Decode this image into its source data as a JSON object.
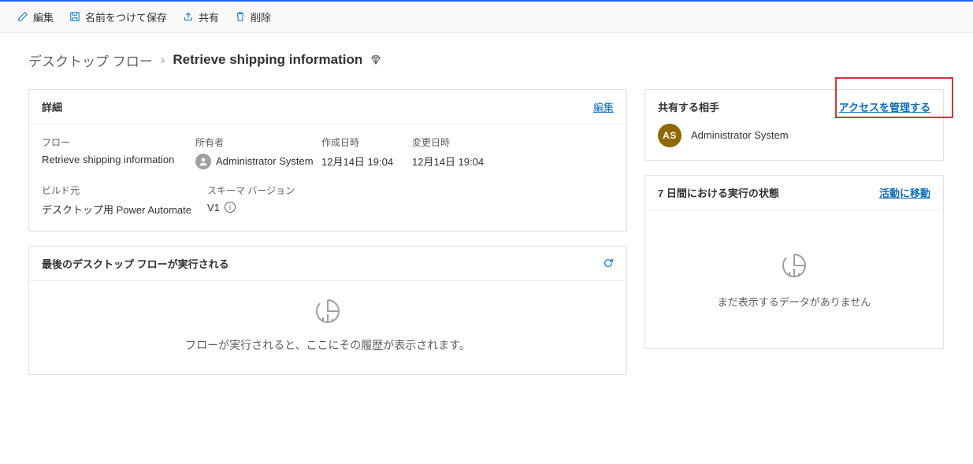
{
  "toolbar": {
    "edit": "編集",
    "save_as": "名前をつけて保存",
    "share": "共有",
    "delete": "削除"
  },
  "breadcrumb": {
    "root": "デスクトップ フロー",
    "current": "Retrieve shipping information"
  },
  "details": {
    "title": "詳細",
    "edit_link": "編集",
    "flow_label": "フロー",
    "flow_value": "Retrieve shipping information",
    "owner_label": "所有者",
    "owner_value": "Administrator System",
    "created_label": "作成日時",
    "created_value": "12月14日 19:04",
    "modified_label": "変更日時",
    "modified_value": "12月14日 19:04",
    "build_label": "ビルド元",
    "build_value": "デスクトップ用 Power Automate",
    "schema_label": "スキーマ バージョン",
    "schema_value": "V1"
  },
  "runs": {
    "title": "最後のデスクトップ フローが実行される",
    "empty_text": "フローが実行されると、ここにその履歴が表示されます。"
  },
  "share": {
    "title": "共有する相手",
    "manage_link": "アクセスを管理する",
    "user_initials": "AS",
    "user_name": "Administrator System"
  },
  "status": {
    "title": "7 日間における実行の状態",
    "activity_link": "活動に移動",
    "empty_text": "まだ表示するデータがありません"
  }
}
